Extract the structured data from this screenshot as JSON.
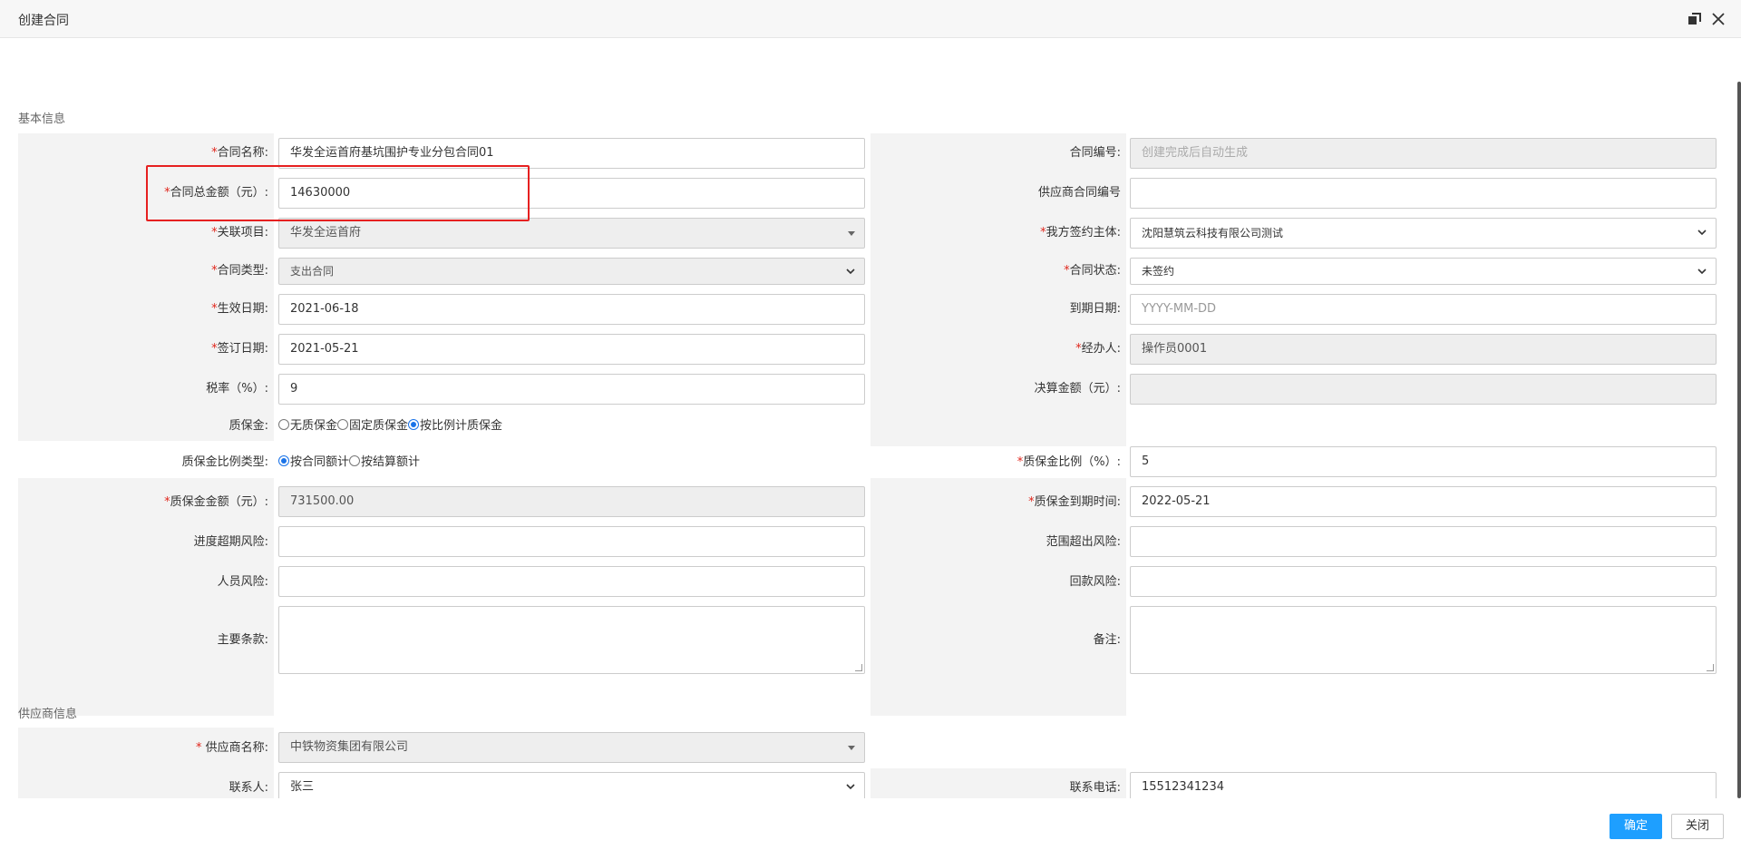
{
  "dialog": {
    "title": "创建合同",
    "ok_label": "确定",
    "close_label": "关闭"
  },
  "basic": {
    "section_title": "基本信息",
    "contract_name": {
      "label": "合同名称:",
      "value": "华发全运首府基坑围护专业分包合同01"
    },
    "contract_no": {
      "label": "合同编号:",
      "placeholder": "创建完成后自动生成"
    },
    "total_amount": {
      "label": "合同总金额（元）:",
      "value": "14630000"
    },
    "supplier_contract_no": {
      "label": "供应商合同编号",
      "value": ""
    },
    "project": {
      "label": "关联项目:",
      "value": "华发全运首府"
    },
    "our_party": {
      "label": "我方签约主体:",
      "value": "沈阳慧筑云科技有限公司测试"
    },
    "contract_type": {
      "label": "合同类型:",
      "value": "支出合同"
    },
    "contract_status": {
      "label": "合同状态:",
      "value": "未签约"
    },
    "effective_date": {
      "label": "生效日期:",
      "value": "2021-06-18"
    },
    "expire_date": {
      "label": "到期日期:",
      "placeholder": "YYYY-MM-DD"
    },
    "sign_date": {
      "label": "签订日期:",
      "value": "2021-05-21"
    },
    "handler": {
      "label": "经办人:",
      "value": "操作员0001"
    },
    "tax_rate": {
      "label": "税率（%）:",
      "value": "9"
    },
    "settle_amount": {
      "label": "决算金额（元）:",
      "value": ""
    },
    "retention": {
      "label": "质保金:",
      "options": [
        "无质保金",
        "固定质保金",
        "按比例计质保金"
      ],
      "selected": "按比例计质保金"
    },
    "retention_ratio_type": {
      "label": "质保金比例类型:",
      "options": [
        "按合同额计",
        "按结算额计"
      ],
      "selected": "按合同额计"
    },
    "retention_ratio": {
      "label": "质保金比例（%）:",
      "value": "5"
    },
    "retention_amount": {
      "label": "质保金金额（元）:",
      "value": "731500.00"
    },
    "retention_due": {
      "label": "质保金到期时间:",
      "value": "2022-05-21"
    },
    "schedule_risk": {
      "label": "进度超期风险:",
      "value": ""
    },
    "scope_risk": {
      "label": "范围超出风险:",
      "value": ""
    },
    "personnel_risk": {
      "label": "人员风险:",
      "value": ""
    },
    "payment_risk": {
      "label": "回款风险:",
      "value": ""
    },
    "main_terms": {
      "label": "主要条款:",
      "value": ""
    },
    "remarks": {
      "label": "备注:",
      "value": ""
    }
  },
  "supplier": {
    "section_title": "供应商信息",
    "name": {
      "label": " 供应商名称:",
      "value": "中铁物资集团有限公司"
    },
    "contact": {
      "label": "联系人:",
      "value": "张三"
    },
    "phone": {
      "label": "联系电话:",
      "value": "15512341234"
    }
  },
  "colors": {
    "required": "#e0261c",
    "primary": "#1e9fff",
    "highlight": "#e62020"
  }
}
